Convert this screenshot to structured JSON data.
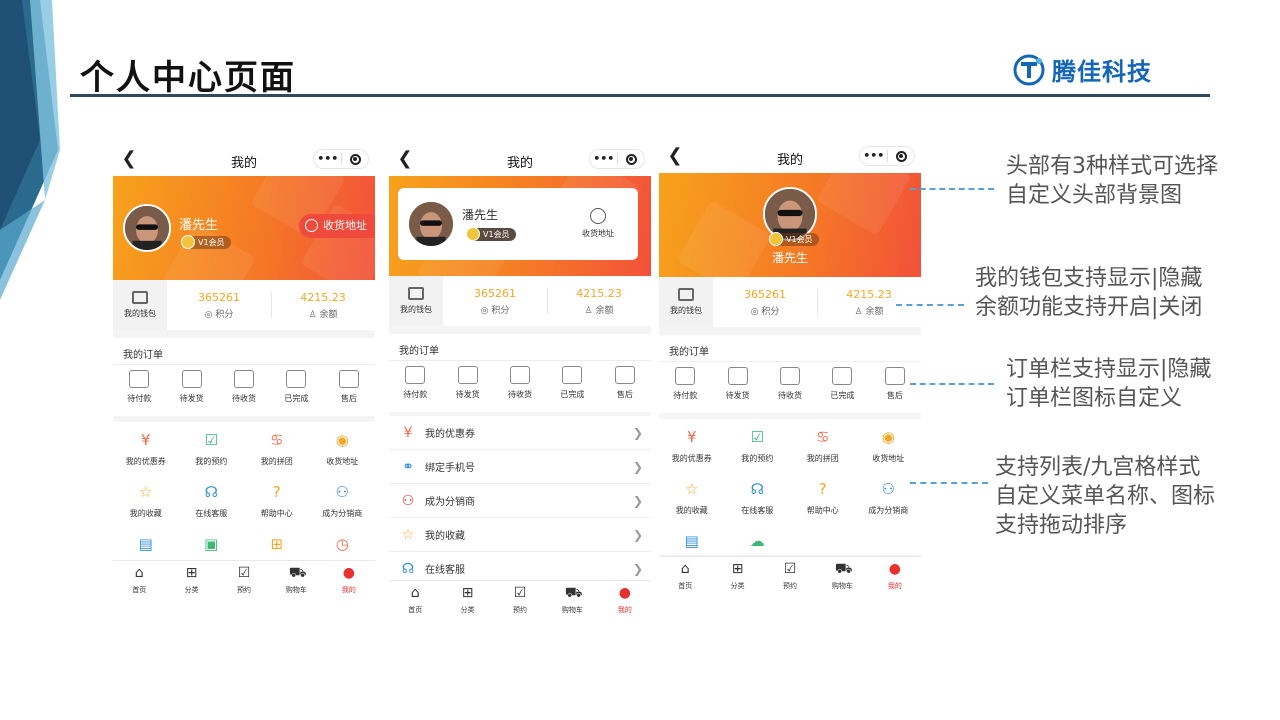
{
  "slide": {
    "title": "个人中心页面",
    "logo_text": "腾佳科技",
    "colors": {
      "accent_orange": "#f57a25",
      "accent_red": "#e8312f",
      "stat_gold": "#f5a623",
      "rule_navy": "#2f4a5e",
      "dash_blue": "#5aa0d8",
      "logo_blue": "#1565b8"
    }
  },
  "phone": {
    "nav_title": "我的",
    "back_icon": "chevron-left-icon",
    "user_name": "潘先生",
    "vip_label": "V1会员",
    "address_label": "收货地址",
    "wallet_label": "我的钱包",
    "points_value": "365261",
    "points_label": "积分",
    "balance_value": "4215.23",
    "balance_label": "余额",
    "orders_title": "我的订单",
    "orders": [
      {
        "label": "待付款",
        "icon": "wallet-icon"
      },
      {
        "label": "待发货",
        "icon": "truck-icon"
      },
      {
        "label": "待收货",
        "icon": "box-icon"
      },
      {
        "label": "已完成",
        "icon": "check-doc-icon"
      },
      {
        "label": "售后",
        "icon": "shield-icon"
      }
    ],
    "menu": [
      {
        "label": "我的优惠券",
        "icon": "coupon-icon",
        "color": "#f06a4a"
      },
      {
        "label": "我的预约",
        "icon": "calendar-check-icon",
        "color": "#3cb878"
      },
      {
        "label": "我的拼团",
        "icon": "group-icon",
        "color": "#f06a4a"
      },
      {
        "label": "收货地址",
        "icon": "location-icon",
        "color": "#f5a623"
      },
      {
        "label": "我的收藏",
        "icon": "star-icon",
        "color": "#f5a623"
      },
      {
        "label": "在线客服",
        "icon": "headset-icon",
        "color": "#2f8fd8"
      },
      {
        "label": "帮助中心",
        "icon": "help-icon",
        "color": "#f5a623"
      },
      {
        "label": "成为分销商",
        "icon": "network-icon",
        "color": "#2f8fd8"
      }
    ],
    "list_menu": [
      {
        "label": "我的优惠券",
        "icon": "coupon-icon",
        "color": "#f06a4a"
      },
      {
        "label": "绑定手机号",
        "icon": "link-icon",
        "color": "#2f8fd8"
      },
      {
        "label": "成为分销商",
        "icon": "network-icon",
        "color": "#e8312f"
      },
      {
        "label": "我的收藏",
        "icon": "star-icon",
        "color": "#f5a623"
      },
      {
        "label": "在线客服",
        "icon": "headset-icon",
        "color": "#2f8fd8"
      }
    ],
    "tabs": [
      {
        "label": "首页",
        "icon": "home-icon"
      },
      {
        "label": "分类",
        "icon": "grid-icon"
      },
      {
        "label": "预约",
        "icon": "calendar-icon"
      },
      {
        "label": "购物车",
        "icon": "cart-icon"
      },
      {
        "label": "我的",
        "icon": "user-icon"
      }
    ]
  },
  "annotations": [
    {
      "line1": "头部有3种样式可选择",
      "line2": "自定义头部背景图"
    },
    {
      "line1": "我的钱包支持显示|隐藏",
      "line2": "余额功能支持开启|关闭"
    },
    {
      "line1": "订单栏支持显示|隐藏",
      "line2": "订单栏图标自定义"
    },
    {
      "line1": "支持列表/九宫格样式",
      "line2": "自定义菜单名称、图标",
      "line3": "支持拖动排序"
    }
  ]
}
